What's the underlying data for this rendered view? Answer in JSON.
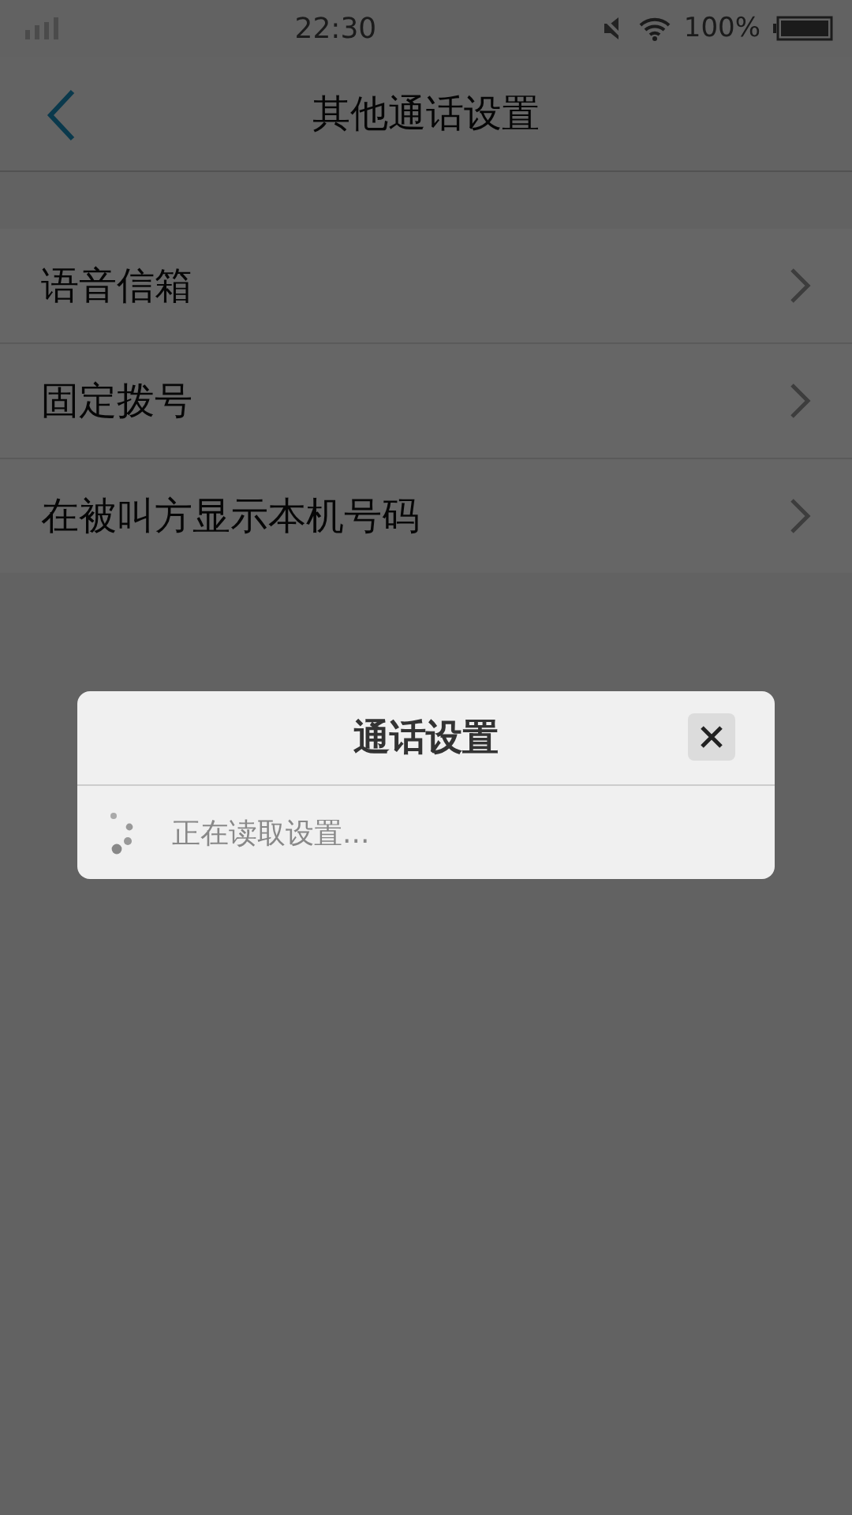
{
  "status_bar": {
    "time": "22:30",
    "battery": "100%"
  },
  "header": {
    "title": "其他通话设置"
  },
  "settings": [
    {
      "label": "语音信箱"
    },
    {
      "label": "固定拨号"
    },
    {
      "label": "在被叫方显示本机号码"
    }
  ],
  "dialog": {
    "title": "通话设置",
    "message": "正在读取设置..."
  }
}
